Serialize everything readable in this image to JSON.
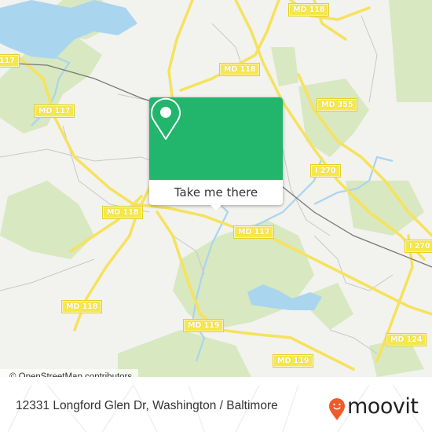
{
  "map": {
    "road_labels": [
      {
        "id": "md-117-top-left",
        "text": "117"
      },
      {
        "id": "md-118-top",
        "text": "MD 118"
      },
      {
        "id": "md-118-mid",
        "text": "MD 118"
      },
      {
        "id": "md-117-left",
        "text": "MD 117"
      },
      {
        "id": "md-355",
        "text": "MD 355"
      },
      {
        "id": "i-270-mid",
        "text": "I 270"
      },
      {
        "id": "md-118-left",
        "text": "MD 118"
      },
      {
        "id": "md-117-center",
        "text": "MD 117"
      },
      {
        "id": "i-270-right",
        "text": "I 270"
      },
      {
        "id": "md-118-bottom-left",
        "text": "MD 118"
      },
      {
        "id": "md-119-center",
        "text": "MD 119"
      },
      {
        "id": "md-124",
        "text": "MD 124"
      },
      {
        "id": "md-119-bottom",
        "text": "MD 119"
      }
    ],
    "attribution": "© OpenStreetMap contributors",
    "colors": {
      "land": "#f2f2ef",
      "water": "#a9d5ef",
      "park": "#d8e8c0",
      "major_road": "#f6e25c",
      "minor_road": "#c8c8c4",
      "railway": "#777777"
    }
  },
  "popup": {
    "icon": "location-pin-icon",
    "button_label": "Take me there",
    "color": "#21b66b"
  },
  "footer": {
    "address": "12331 Longford Glen Dr, Washington / Baltimore",
    "logo_text": "moovit",
    "logo_color": "#f05a28"
  }
}
